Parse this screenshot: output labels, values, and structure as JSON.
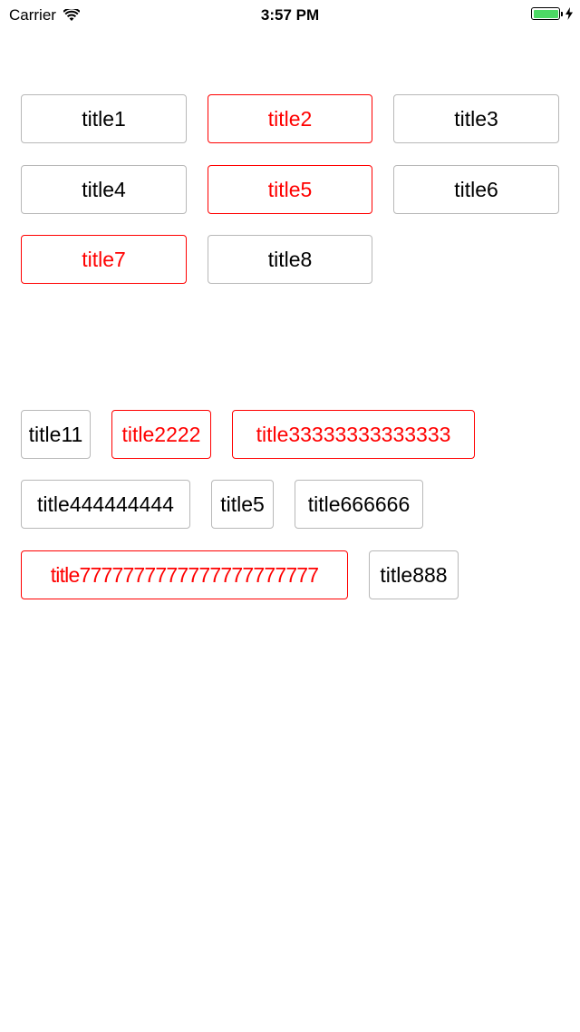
{
  "status_bar": {
    "carrier": "Carrier",
    "time": "3:57 PM",
    "battery_level": 1.0,
    "battery_color": "#4cd964"
  },
  "colors": {
    "selected": "#ff0000",
    "normal_text": "#000000",
    "normal_border": "#b8b8b8"
  },
  "grid_tags": [
    {
      "label": "title1",
      "selected": false
    },
    {
      "label": "title2",
      "selected": true
    },
    {
      "label": "title3",
      "selected": false
    },
    {
      "label": "title4",
      "selected": false
    },
    {
      "label": "title5",
      "selected": true
    },
    {
      "label": "title6",
      "selected": false
    },
    {
      "label": "title7",
      "selected": true
    },
    {
      "label": "title8",
      "selected": false
    }
  ],
  "flow_tags": [
    {
      "label": "title11",
      "selected": false
    },
    {
      "label": "title2222",
      "selected": true
    },
    {
      "label": "title33333333333333",
      "selected": true
    },
    {
      "label": "title444444444",
      "selected": false
    },
    {
      "label": "title5",
      "selected": false
    },
    {
      "label": "title666666",
      "selected": false
    },
    {
      "label": "title7777777777777777777777",
      "selected": true
    },
    {
      "label": "title888",
      "selected": false
    }
  ]
}
